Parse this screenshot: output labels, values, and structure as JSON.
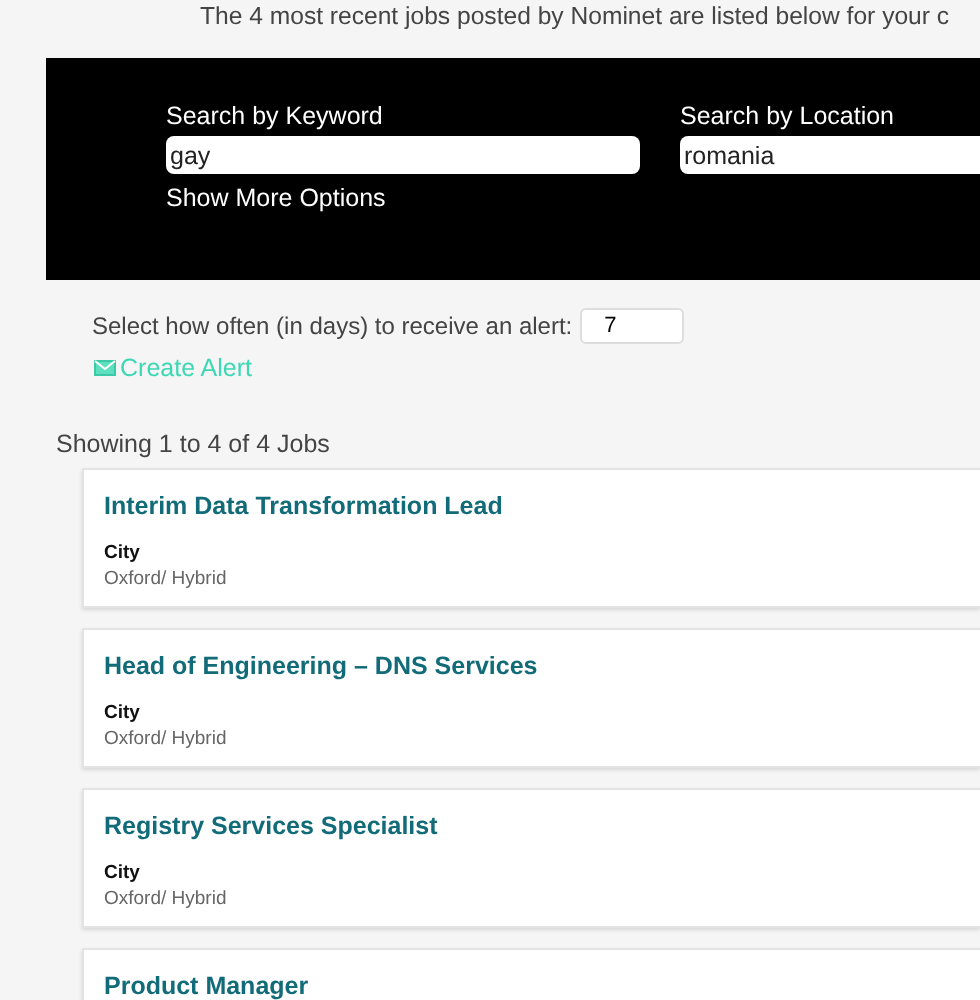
{
  "intro": "The 4 most recent jobs posted by Nominet are listed below for your c",
  "search": {
    "keyword_label": "Search by Keyword",
    "keyword_value": "gay",
    "location_label": "Search by Location",
    "location_value": "romania",
    "more_options": "Show More Options"
  },
  "alert": {
    "label": "Select how often (in days) to receive an alert:",
    "days": "7",
    "create": "Create Alert"
  },
  "summary": "Showing 1 to 4 of 4 Jobs",
  "jobs": [
    {
      "title": "Interim Data Transformation Lead",
      "field": "City",
      "location": "Oxford/ Hybrid"
    },
    {
      "title": "Head of Engineering – DNS Services",
      "field": "City",
      "location": "Oxford/ Hybrid"
    },
    {
      "title": "Registry Services Specialist",
      "field": "City",
      "location": "Oxford/ Hybrid"
    },
    {
      "title": "Product Manager"
    }
  ]
}
